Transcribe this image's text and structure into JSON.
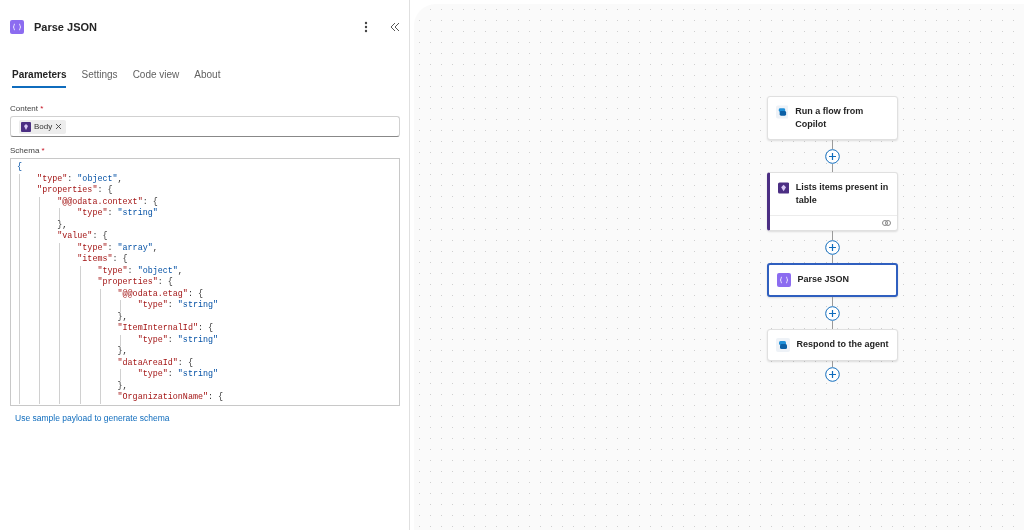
{
  "panel": {
    "title": "Parse JSON",
    "tabs": [
      {
        "label": "Parameters",
        "selected": true
      },
      {
        "label": "Settings",
        "selected": false
      },
      {
        "label": "Code view",
        "selected": false
      },
      {
        "label": "About",
        "selected": false
      }
    ],
    "content": {
      "label": "Content",
      "required_mark": "*",
      "token": "Body"
    },
    "schema": {
      "label": "Schema",
      "required_mark": "*",
      "lines": [
        "{",
        "    \"type\": \"object\",",
        "    \"properties\": {",
        "        \"@@odata.context\": {",
        "            \"type\": \"string\"",
        "        },",
        "        \"value\": {",
        "            \"type\": \"array\",",
        "            \"items\": {",
        "                \"type\": \"object\",",
        "                \"properties\": {",
        "                    \"@@odata.etag\": {",
        "                        \"type\": \"string\"",
        "                    },",
        "                    \"ItemInternalId\": {",
        "                        \"type\": \"string\"",
        "                    },",
        "                    \"dataAreaId\": {",
        "                        \"type\": \"string\"",
        "                    },",
        "                    \"OrganizationName\": {"
      ]
    },
    "link": "Use sample payload to generate schema"
  },
  "flow": {
    "nodes": [
      {
        "kind": "copilot",
        "title": "Run a flow from Copilot",
        "selected": false,
        "accent": false,
        "footer": false
      },
      {
        "kind": "connector",
        "title": "Lists items present in table",
        "selected": false,
        "accent": true,
        "footer": true
      },
      {
        "kind": "variable",
        "title": "Parse JSON",
        "selected": true,
        "accent": false,
        "footer": false
      },
      {
        "kind": "copilot",
        "title": "Respond to the agent",
        "selected": false,
        "accent": false,
        "footer": false
      }
    ]
  }
}
